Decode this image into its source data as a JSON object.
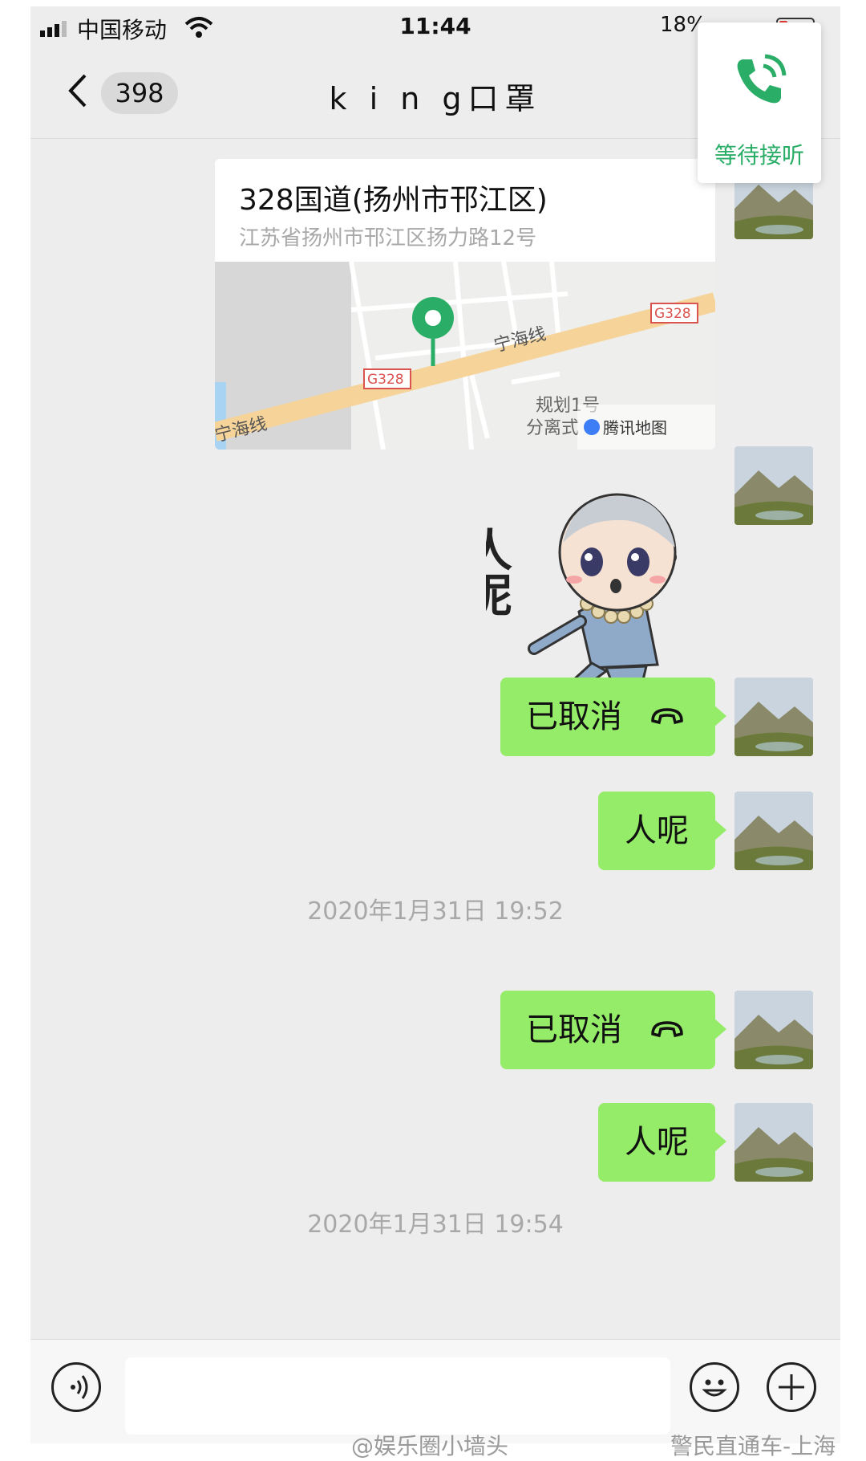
{
  "status_bar": {
    "carrier": "中国移动",
    "time": "11:44",
    "battery": "18%"
  },
  "nav": {
    "back_icon": "chevron-left-icon",
    "unread_count": "398",
    "title": "k i n g口罩"
  },
  "call_overlay": {
    "icon": "phone-icon",
    "label": "等待接听",
    "accent_color": "#2aae67"
  },
  "messages": {
    "location": {
      "name": "328国道(扬州市邗江区)",
      "address": "江苏省扬州市邗江区扬力路12号",
      "map_labels": [
        "宁海线",
        "宁海线",
        "G328",
        "G328",
        "规划1号",
        "分离式",
        "腾讯地图"
      ]
    },
    "sticker_text": "人呢",
    "call1": "已取消",
    "text1": "人呢",
    "time1": "2020年1月31日 19:52",
    "call2": "已取消",
    "text2": "人呢",
    "time2": "2020年1月31日 19:54"
  },
  "input_bar": {
    "voice_icon": "voice-icon",
    "emoji_icon": "emoji-icon",
    "add_icon": "plus-icon"
  },
  "watermarks": [
    "@娱乐圈小墙头",
    "警民直通车-上海"
  ],
  "colors": {
    "bubble": "#95ec69",
    "background": "#ededed"
  }
}
